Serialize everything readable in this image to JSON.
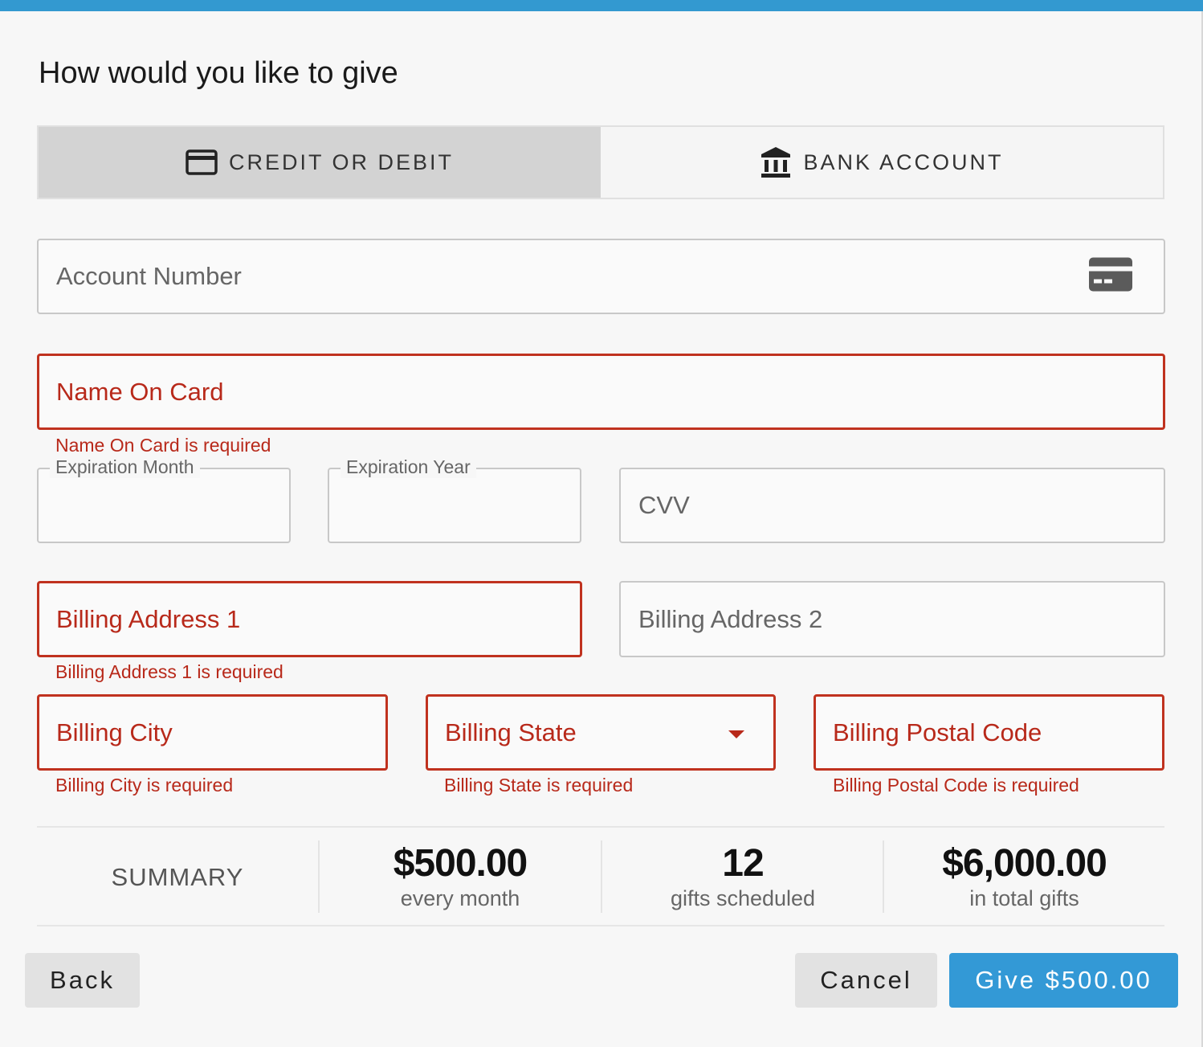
{
  "heading": "How would you like to give",
  "tabs": [
    {
      "label": "CREDIT OR DEBIT",
      "icon": "credit-card-icon",
      "active": true
    },
    {
      "label": "BANK ACCOUNT",
      "icon": "bank-icon",
      "active": false
    }
  ],
  "fields": {
    "account_number": {
      "placeholder": "Account Number"
    },
    "name_on_card": {
      "placeholder": "Name On Card",
      "error": "Name On Card is required"
    },
    "expiration_month": {
      "label": "Expiration Month",
      "value": ""
    },
    "expiration_year": {
      "label": "Expiration Year",
      "value": ""
    },
    "cvv": {
      "placeholder": "CVV"
    },
    "billing_address_1": {
      "placeholder": "Billing Address 1",
      "error": "Billing Address 1 is required"
    },
    "billing_address_2": {
      "placeholder": "Billing Address 2"
    },
    "billing_city": {
      "placeholder": "Billing City",
      "error": "Billing City is required"
    },
    "billing_state": {
      "placeholder": "Billing State",
      "error": "Billing State is required"
    },
    "billing_postal_code": {
      "placeholder": "Billing Postal Code",
      "error": "Billing Postal Code is required"
    }
  },
  "summary": {
    "label": "SUMMARY",
    "amount": {
      "value": "$500.00",
      "caption": "every month"
    },
    "count": {
      "value": "12",
      "caption": "gifts scheduled"
    },
    "total": {
      "value": "$6,000.00",
      "caption": "in total gifts"
    }
  },
  "buttons": {
    "back": "Back",
    "cancel": "Cancel",
    "give": "Give $500.00"
  },
  "colors": {
    "accent": "#3399d6",
    "error": "#b8291a",
    "active_tab": "#d3d3d3"
  }
}
